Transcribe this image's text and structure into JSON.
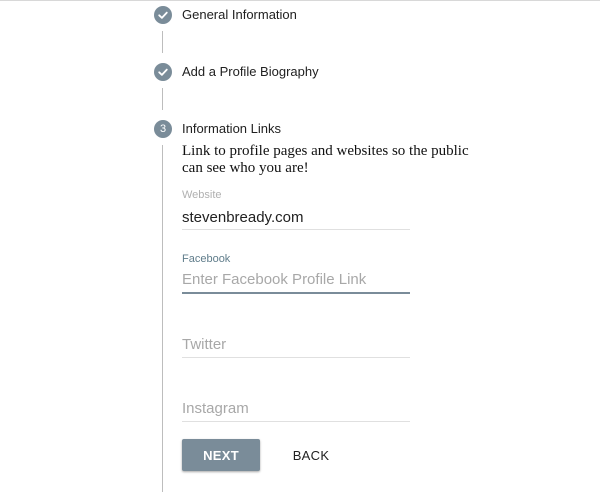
{
  "stepper": {
    "steps": [
      {
        "number": "1",
        "label": "General Information",
        "status": "completed",
        "icon": "check-icon"
      },
      {
        "number": "2",
        "label": "Add a Profile Biography",
        "status": "completed",
        "icon": "check-icon"
      },
      {
        "number": "3",
        "label": "Information Links",
        "status": "active"
      }
    ]
  },
  "content": {
    "description": "Link to profile pages and websites so the public can see who you are!",
    "fields": {
      "website": {
        "label": "Website",
        "value": "stevenbready.com",
        "placeholder": ""
      },
      "facebook": {
        "label": "Facebook",
        "value": "",
        "placeholder": "Enter Facebook Profile Link"
      },
      "twitter": {
        "label": "",
        "value": "",
        "placeholder": "Twitter"
      },
      "instagram": {
        "label": "",
        "value": "",
        "placeholder": "Instagram"
      }
    },
    "buttons": {
      "next": "NEXT",
      "back": "BACK"
    }
  },
  "colors": {
    "accent": "#7a8c99",
    "label_active": "#607d8b",
    "label_idle": "#b0b0b0",
    "divider": "#e0e0e0"
  }
}
